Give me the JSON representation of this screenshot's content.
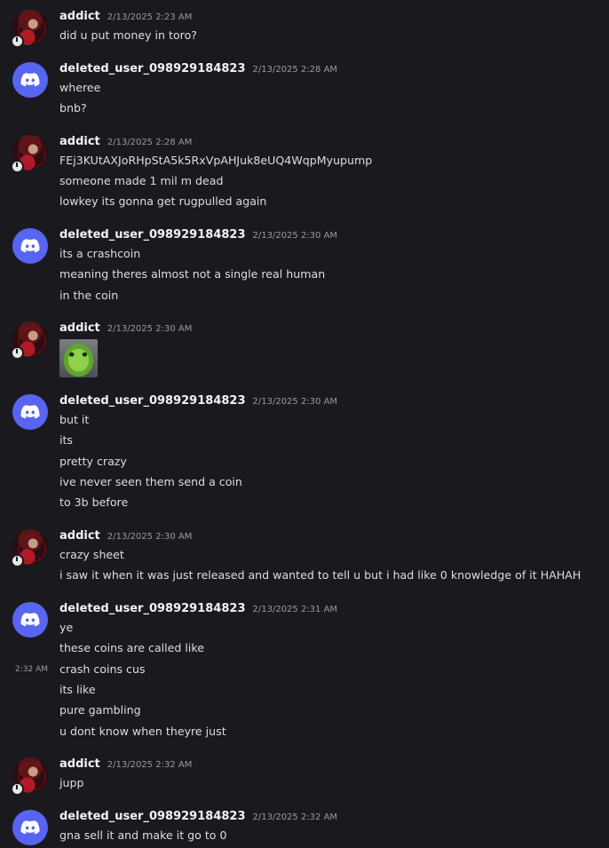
{
  "messages": [
    {
      "author": "addict",
      "avatar": "anime-avatar",
      "timestamp": "2/13/2025 2:23 AM",
      "lines": [
        "did u put money in toro?"
      ]
    },
    {
      "author": "deleted_user_098929184823",
      "avatar": "discord-logo-avatar",
      "timestamp": "2/13/2025 2:28 AM",
      "lines": [
        "wheree",
        "bnb?"
      ]
    },
    {
      "author": "addict",
      "avatar": "anime-avatar",
      "timestamp": "2/13/2025 2:28 AM",
      "lines": [
        "FEj3KUtAXJoRHpStA5k5RxVpAHJuk8eUQ4WqpMyupump",
        "someone made 1 mil m dead",
        "lowkey its gonna get rugpulled again"
      ]
    },
    {
      "author": "deleted_user_098929184823",
      "avatar": "discord-logo-avatar",
      "timestamp": "2/13/2025 2:30 AM",
      "lines": [
        "its a crashcoin",
        "meaning theres almost not a single real human",
        "in the coin"
      ]
    },
    {
      "author": "addict",
      "avatar": "anime-avatar",
      "timestamp": "2/13/2025 2:30 AM",
      "lines": [],
      "sticker": "green-cat-sticker"
    },
    {
      "author": "deleted_user_098929184823",
      "avatar": "discord-logo-avatar",
      "timestamp": "2/13/2025 2:30 AM",
      "lines": [
        "but it",
        "its",
        "pretty crazy",
        "ive never seen them send a coin",
        "to 3b before"
      ]
    },
    {
      "author": "addict",
      "avatar": "anime-avatar",
      "timestamp": "2/13/2025 2:30 AM",
      "lines": [
        "crazy sheet",
        "i saw it when it was just released and wanted to tell u but i had like 0 knowledge of it HAHAH"
      ]
    },
    {
      "author": "deleted_user_098929184823",
      "avatar": "discord-logo-avatar",
      "timestamp": "2/13/2025 2:31 AM",
      "lines": [
        "ye",
        "these coins are called like",
        "crash coins cus",
        "its like",
        "pure gambling",
        "u dont know when theyre just"
      ],
      "side_time": "2:32 AM"
    },
    {
      "author": "addict",
      "avatar": "anime-avatar",
      "timestamp": "2/13/2025 2:32 AM",
      "lines": [
        "jupp"
      ]
    },
    {
      "author": "deleted_user_098929184823",
      "avatar": "discord-logo-avatar",
      "timestamp": "2/13/2025 2:32 AM",
      "lines": [
        "gna sell it and make it go to 0"
      ]
    }
  ],
  "colors": {
    "background": "#1a1a1e",
    "discord_blurple": "#5865f2",
    "text": "#dbdee1",
    "username": "#f2f3f5",
    "timestamp": "#949ba4"
  }
}
